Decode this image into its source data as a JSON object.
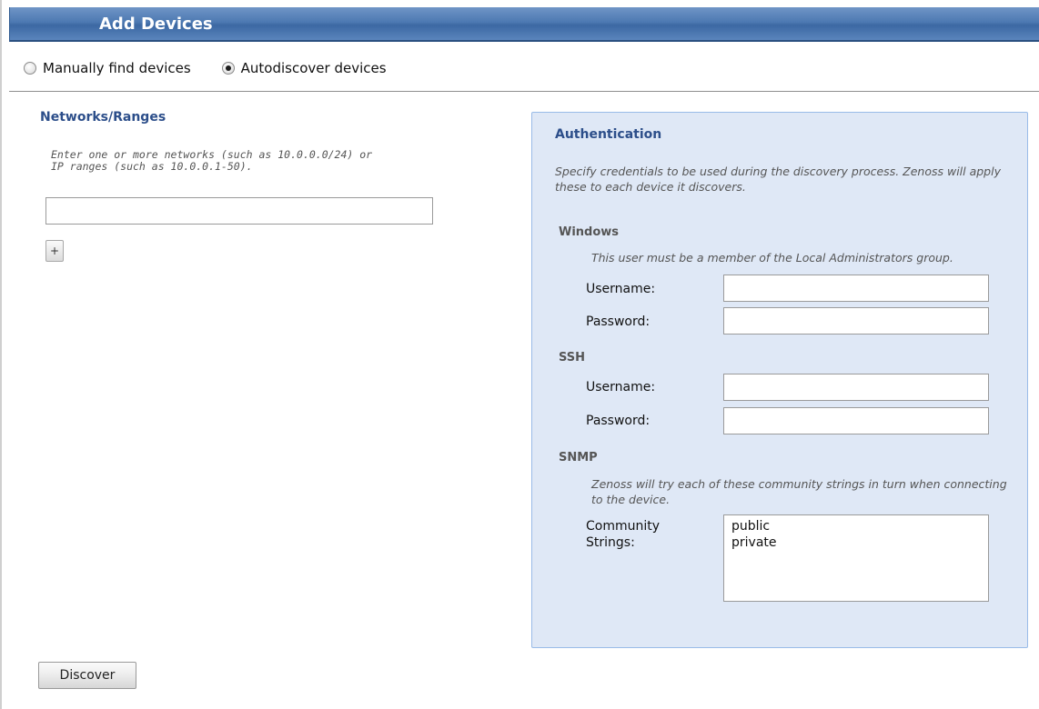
{
  "window": {
    "title": "Add Devices"
  },
  "mode": {
    "options": [
      {
        "label": "Manually find devices",
        "selected": false
      },
      {
        "label": "Autodiscover devices",
        "selected": true
      }
    ]
  },
  "networks": {
    "heading": "Networks/Ranges",
    "hint_line1": "Enter one or more networks (such as 10.0.0.0/24) or",
    "hint_line2": "IP ranges (such as 10.0.0.1-50).",
    "input_value": "",
    "add_button_label": "+"
  },
  "auth": {
    "heading": "Authentication",
    "description": "Specify credentials to be used during the discovery process. Zenoss will apply these to each device it discovers.",
    "windows": {
      "label": "Windows",
      "note": "This user must be a member of the Local Administrators group.",
      "username_label": "Username:",
      "password_label": "Password:",
      "username_value": "",
      "password_value": ""
    },
    "ssh": {
      "label": "SSH",
      "username_label": "Username:",
      "password_label": "Password:",
      "username_value": "",
      "password_value": ""
    },
    "snmp": {
      "label": "SNMP",
      "note": "Zenoss will try each of these community strings in turn when connecting to the device.",
      "community_label_line1": "Community",
      "community_label_line2": "Strings:",
      "community_strings": "public\nprivate"
    }
  },
  "actions": {
    "discover_label": "Discover"
  },
  "colors": {
    "title_bar": "#4d79b2",
    "heading_blue": "#2c4e8a",
    "panel_bg": "#dfe8f6",
    "panel_border": "#99bbe8"
  }
}
